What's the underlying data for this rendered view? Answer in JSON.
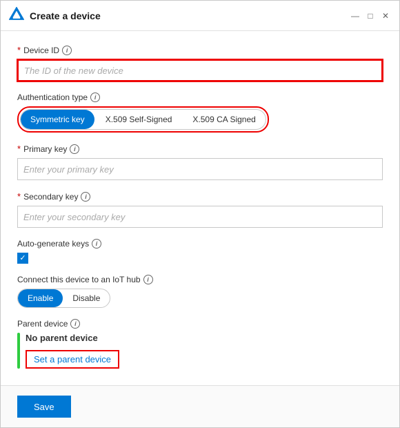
{
  "window": {
    "title": "Create a device",
    "controls": {
      "minimize": "—",
      "restore": "□",
      "close": "✕"
    }
  },
  "form": {
    "device_id": {
      "label": "Device ID",
      "required": true,
      "placeholder": "The ID of the new device",
      "value": ""
    },
    "authentication_type": {
      "label": "Authentication type",
      "options": [
        {
          "id": "symmetric_key",
          "label": "Symmetric key",
          "active": true
        },
        {
          "id": "x509_self_signed",
          "label": "X.509 Self-Signed",
          "active": false
        },
        {
          "id": "x509_ca_signed",
          "label": "X.509 CA Signed",
          "active": false
        }
      ]
    },
    "primary_key": {
      "label": "Primary key",
      "required": true,
      "placeholder": "Enter your primary key",
      "value": ""
    },
    "secondary_key": {
      "label": "Secondary key",
      "required": true,
      "placeholder": "Enter your secondary key",
      "value": ""
    },
    "auto_generate": {
      "label": "Auto-generate keys",
      "checked": true
    },
    "connect_to_hub": {
      "label": "Connect this device to an IoT hub",
      "options": [
        {
          "id": "enable",
          "label": "Enable",
          "active": true
        },
        {
          "id": "disable",
          "label": "Disable",
          "active": false
        }
      ]
    },
    "parent_device": {
      "label": "Parent device",
      "current_value": "No parent device",
      "set_parent_label": "Set a parent device"
    }
  },
  "footer": {
    "save_label": "Save"
  }
}
